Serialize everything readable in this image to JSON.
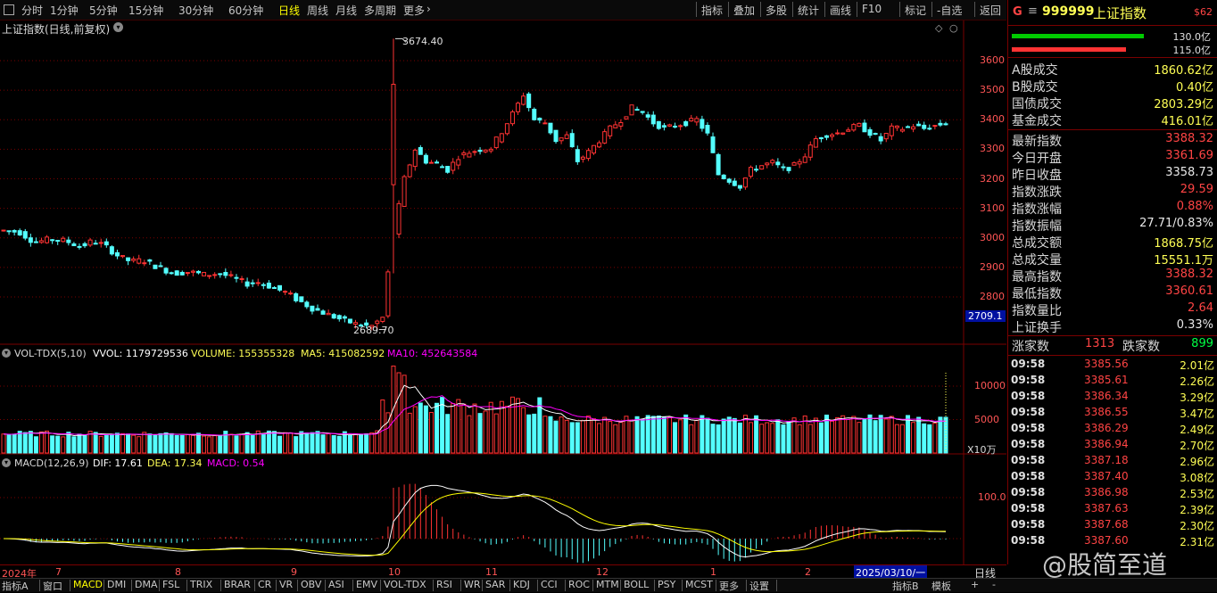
{
  "toolbar": {
    "periods": [
      "分时",
      "1分钟",
      "5分钟",
      "15分钟",
      "30分钟",
      "60分钟",
      "日线",
      "周线",
      "月线",
      "多周期",
      "更多"
    ],
    "active_period": "日线",
    "right_tools": [
      "指标",
      "叠加",
      "多股",
      "统计",
      "画线",
      "F10",
      "标记",
      "-自选",
      "返回"
    ]
  },
  "chart_title": "上证指数(日线,前复权)",
  "price_axis_ticks": [
    "3600",
    "3500",
    "3400",
    "3300",
    "3200",
    "3100",
    "3000",
    "2900",
    "2800"
  ],
  "current_price_tag": "2709.1",
  "annotations": {
    "high": "3674.40",
    "low": "2689.70"
  },
  "vol_header": {
    "name": "VOL-TDX(5,10)",
    "vvol": "VVOL: 1179729536",
    "volume": "VOLUME: 155355328",
    "ma5": "MA5: 415082592",
    "ma10": "MA10: 452643584"
  },
  "vol_axis_ticks": [
    "10000",
    "5000"
  ],
  "vol_unit": "X10万",
  "macd_header": {
    "name": "MACD(12,26,9)",
    "dif": "DIF: 17.61",
    "dea": "DEA: 17.34",
    "macd": "MACD: 0.54"
  },
  "macd_axis_ticks": [
    "100.0"
  ],
  "months": [
    "2024年",
    "7",
    "8",
    "9",
    "10",
    "11",
    "12",
    "1",
    "2"
  ],
  "date_cursor": "2025/03/10/一",
  "timeframe_label": "日线",
  "bottom_tabs": [
    "指标A",
    "窗口",
    "MACD",
    "DMI",
    "DMA",
    "FSL",
    "TRIX",
    "BRAR",
    "CR",
    "VR",
    "OBV",
    "ASI",
    "EMV",
    "VOL-TDX",
    "RSI",
    "WR",
    "SAR",
    "KDJ",
    "CCI",
    "ROC",
    "MTM",
    "BOLL",
    "PSY",
    "MCST",
    "更多",
    "设置"
  ],
  "bottom_right": [
    "指标B",
    "模板",
    "+",
    "-"
  ],
  "quote": {
    "code": "999999",
    "name": "上证指数",
    "badge": "$62",
    "bar1_value": "130.0亿",
    "bar2_value": "115.0亿",
    "turnover": [
      {
        "k": "A股成交",
        "v": "1860.62亿"
      },
      {
        "k": "B股成交",
        "v": "0.40亿"
      },
      {
        "k": "国债成交",
        "v": "2803.29亿"
      },
      {
        "k": "基金成交",
        "v": "416.01亿"
      }
    ],
    "stats": [
      {
        "k": "最新指数",
        "v": "3388.32",
        "c": "#ff4444"
      },
      {
        "k": "今日开盘",
        "v": "3361.69",
        "c": "#ff4444"
      },
      {
        "k": "昨日收盘",
        "v": "3358.73",
        "c": "#e8e8e8"
      },
      {
        "k": "指数涨跌",
        "v": "29.59",
        "c": "#ff4444"
      },
      {
        "k": "指数涨幅",
        "v": "0.88%",
        "c": "#ff4444"
      },
      {
        "k": "指数振幅",
        "v": "27.71/0.83%",
        "c": "#e8e8e8"
      },
      {
        "k": "总成交额",
        "v": "1868.75亿",
        "c": "#ffff55"
      },
      {
        "k": "总成交量",
        "v": "15551.1万",
        "c": "#ffff55"
      },
      {
        "k": "最高指数",
        "v": "3388.32",
        "c": "#ff4444"
      },
      {
        "k": "最低指数",
        "v": "3360.61",
        "c": "#ff4444"
      },
      {
        "k": "指数量比",
        "v": "2.64",
        "c": "#ff4444"
      },
      {
        "k": "上证换手",
        "v": "0.33%",
        "c": "#e8e8e8"
      }
    ],
    "up_label": "涨家数",
    "up_count": "1313",
    "down_label": "跌家数",
    "down_count": "899",
    "ticks": [
      {
        "t": "09:58",
        "p": "3385.56",
        "v": "2.01亿"
      },
      {
        "t": "09:58",
        "p": "3385.61",
        "v": "2.26亿"
      },
      {
        "t": "09:58",
        "p": "3386.34",
        "v": "3.29亿"
      },
      {
        "t": "09:58",
        "p": "3386.55",
        "v": "3.47亿"
      },
      {
        "t": "09:58",
        "p": "3386.29",
        "v": "2.49亿"
      },
      {
        "t": "09:58",
        "p": "3386.94",
        "v": "2.70亿"
      },
      {
        "t": "09:58",
        "p": "3387.18",
        "v": "2.96亿"
      },
      {
        "t": "09:58",
        "p": "3387.40",
        "v": "3.08亿"
      },
      {
        "t": "09:58",
        "p": "3386.98",
        "v": "2.53亿"
      },
      {
        "t": "09:58",
        "p": "3387.63",
        "v": "2.39亿"
      },
      {
        "t": "09:58",
        "p": "3387.68",
        "v": "2.30亿"
      },
      {
        "t": "09:58",
        "p": "3387.60",
        "v": "2.31亿"
      }
    ]
  },
  "watermark": "@股简至道",
  "colors": {
    "up": "#ff3333",
    "down": "#54ffff",
    "ma5": "#ffffff",
    "ma10": "#ff00ff",
    "dea": "#ffff00",
    "grid": "#7a0000"
  }
}
